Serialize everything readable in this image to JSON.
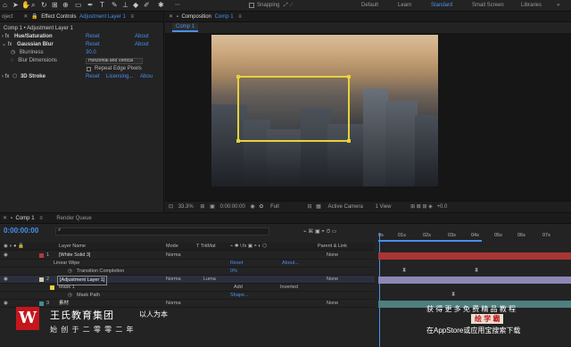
{
  "toolbar": {
    "snapping_label": "Snapping",
    "workspaces": [
      "Default",
      "Learn",
      "Standard",
      "Small Screen",
      "Libraries"
    ],
    "active_workspace": "Standard"
  },
  "effect_controls": {
    "tab_label": "Effect Controls",
    "tab_layer": "Adjustment Layer 1",
    "breadcrumb": "Comp 1 • Adjustment Layer 1",
    "effects": [
      {
        "name": "Hue/Saturation",
        "reset": "Reset",
        "about": "About"
      },
      {
        "name": "Gaussian Blur",
        "reset": "Reset",
        "about": "About"
      },
      {
        "name": "3D Stroke",
        "reset": "Reset",
        "licensing": "Licensing...",
        "about": "Abou"
      }
    ],
    "blurriness_label": "Blurriness",
    "blurriness_value": "30.0",
    "blur_dimensions_label": "Blur Dimensions",
    "blur_dimensions_value": "Horizontal and Vertical",
    "repeat_edge_label": "Repeat Edge Pixels"
  },
  "composition": {
    "tab_label": "Composition",
    "tab_comp": "Comp 1",
    "sub_tab": "Comp 1",
    "zoom": "33.3%",
    "time": "0:00:00:00",
    "resolution": "Full",
    "camera": "Active Camera",
    "view": "1 View",
    "exposure": "+0.0"
  },
  "timeline": {
    "tab_comp": "Comp 1",
    "tab_render": "Render Queue",
    "timecode": "0:00:00:00",
    "columns": {
      "layer_name": "Layer Name",
      "mode": "Mode",
      "trkmat": "T TrkMat",
      "parent": "Parent & Link"
    },
    "ruler": [
      "0s",
      "01s",
      "02s",
      "03s",
      "04s",
      "05s",
      "06s",
      "07s"
    ],
    "rows": [
      {
        "num": "1",
        "name": "[White Solid 3]",
        "mode": "Norma",
        "parent": "None"
      },
      {
        "name": "Linear Wipe",
        "reset": "Reset",
        "about": "About..."
      },
      {
        "name": "Transition Completion",
        "value": "0%"
      },
      {
        "num": "2",
        "name": "[Adjustment Layer 1]",
        "mode": "Norma",
        "trkmat": "Luma",
        "parent": "None"
      },
      {
        "name": "Mask 1",
        "mode": "Add",
        "inverted": "Inverted"
      },
      {
        "name": "Mask Path",
        "value": "Shape..."
      },
      {
        "num": "3",
        "name": "素材",
        "mode": "Norma",
        "parent": "None"
      }
    ]
  },
  "watermark": {
    "company": "王氏教育集团",
    "slogan": "以人为本",
    "founded": "始 创 于 二 零 零 二 年",
    "promo_line1": "获 得 更 多 免 费 精 品 教 程",
    "promo_brand": "绘 学 霸",
    "promo_line3": "在AppStore或应用宝搜索下载",
    "logo_letter": "W",
    "logo_color": "#c4161c"
  }
}
